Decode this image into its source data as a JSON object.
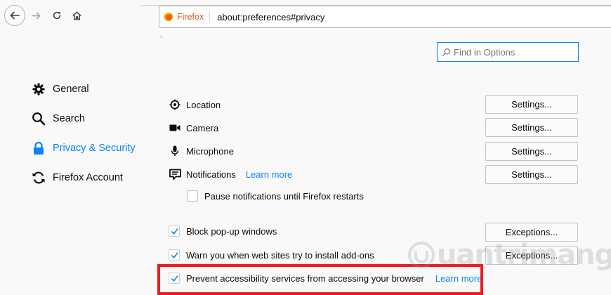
{
  "toolbar": {
    "back_icon": "back-arrow-icon",
    "forward_icon": "forward-arrow-icon",
    "reload_icon": "reload-icon",
    "home_icon": "home-icon",
    "identity_label": "Firefox",
    "url": "about:preferences#privacy"
  },
  "search": {
    "placeholder": "Find in Options",
    "value": ""
  },
  "sidebar": {
    "items": [
      {
        "label": "General",
        "icon": "gear-icon",
        "selected": false
      },
      {
        "label": "Search",
        "icon": "search-icon",
        "selected": false
      },
      {
        "label": "Privacy & Security",
        "icon": "lock-icon",
        "selected": true
      },
      {
        "label": "Firefox Account",
        "icon": "sync-icon",
        "selected": false
      }
    ]
  },
  "permissions": {
    "rows": [
      {
        "label": "Location",
        "icon": "location-icon",
        "button": "Settings..."
      },
      {
        "label": "Camera",
        "icon": "camera-icon",
        "button": "Settings..."
      },
      {
        "label": "Microphone",
        "icon": "microphone-icon",
        "button": "Settings..."
      },
      {
        "label": "Notifications",
        "icon": "notification-icon",
        "button": "Settings...",
        "link": "Learn more"
      }
    ],
    "pause_notifications": {
      "label": "Pause notifications until Firefox restarts",
      "checked": false
    },
    "block_popups": {
      "label": "Block pop-up windows",
      "checked": true,
      "button": "Exceptions..."
    },
    "warn_addons": {
      "label": "Warn you when web sites try to install add-ons",
      "checked": true,
      "button": "Exceptions..."
    },
    "prevent_accessibility": {
      "label": "Prevent accessibility services from accessing your browser",
      "checked": true,
      "link": "Learn more"
    }
  },
  "watermark": {
    "text": "uantrimang"
  },
  "colors": {
    "accent": "#0a84ff",
    "highlight": "#ee1b24",
    "firefox_orange": "#d7572b"
  }
}
